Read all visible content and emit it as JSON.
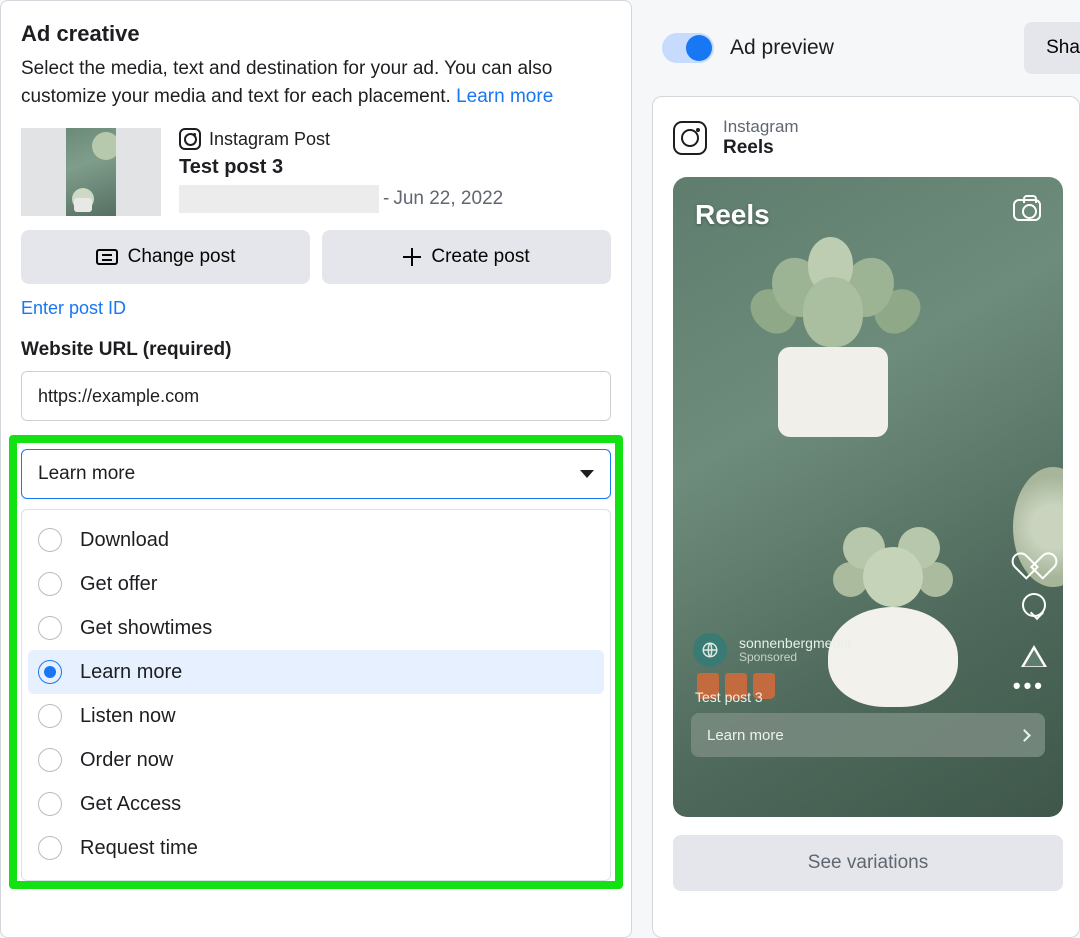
{
  "ad_creative": {
    "title": "Ad creative",
    "description": "Select the media, text and destination for your ad. You can also customize your media and text for each placement. ",
    "learn_more": "Learn more",
    "post": {
      "platform_label": "Instagram Post",
      "title": "Test post 3",
      "date_prefix": "- ",
      "date": "Jun 22, 2022"
    },
    "buttons": {
      "change_post": "Change post",
      "create_post": "Create post"
    },
    "enter_post_id": "Enter post ID",
    "url_label": "Website URL (required)",
    "url_value": "https://example.com",
    "cta": {
      "selected": "Learn more",
      "options": [
        {
          "label": "Download",
          "selected": false
        },
        {
          "label": "Get offer",
          "selected": false
        },
        {
          "label": "Get showtimes",
          "selected": false
        },
        {
          "label": "Learn more",
          "selected": true
        },
        {
          "label": "Listen now",
          "selected": false
        },
        {
          "label": "Order now",
          "selected": false
        },
        {
          "label": "Get Access",
          "selected": false
        },
        {
          "label": "Request time",
          "selected": false
        }
      ]
    }
  },
  "preview": {
    "toggle_label": "Ad preview",
    "share_label": "Sha",
    "placement_platform": "Instagram",
    "placement_name": "Reels",
    "reels_label": "Reels",
    "account_name": "sonnenbergmedia",
    "sponsored_label": "Sponsored",
    "caption": "Test post 3",
    "cta_label": "Learn more",
    "see_variations": "See variations",
    "dots": "•••"
  }
}
